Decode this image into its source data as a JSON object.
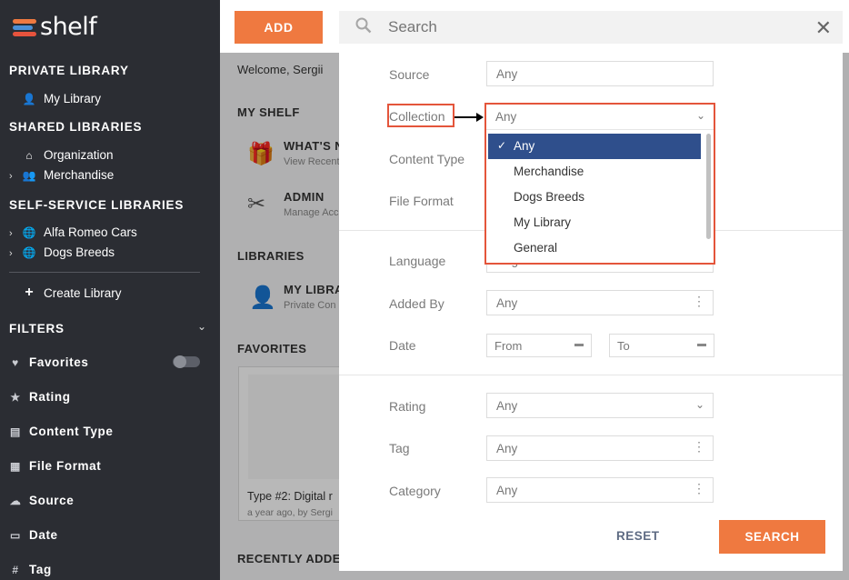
{
  "app": {
    "logo_text": "shelf"
  },
  "sidebar": {
    "private_library": {
      "heading": "PRIVATE LIBRARY",
      "items": [
        {
          "label": "My Library",
          "icon": "lock-user-icon"
        }
      ]
    },
    "shared_libraries": {
      "heading": "SHARED LIBRARIES",
      "items": [
        {
          "label": "Organization",
          "icon": "building-icon"
        },
        {
          "label": "Merchandise",
          "icon": "users-icon"
        }
      ]
    },
    "self_service_libraries": {
      "heading": "SELF-SERVICE LIBRARIES",
      "items": [
        {
          "label": "Alfa Romeo Cars",
          "icon": "globe-icon"
        },
        {
          "label": "Dogs Breeds",
          "icon": "globe-icon"
        }
      ]
    },
    "create_library": "Create Library",
    "filters": {
      "heading": "FILTERS",
      "items": [
        {
          "label": "Favorites",
          "icon": "heart-icon"
        },
        {
          "label": "Rating",
          "icon": "star-icon"
        },
        {
          "label": "Content Type",
          "icon": "document-icon"
        },
        {
          "label": "File Format",
          "icon": "file-icon"
        },
        {
          "label": "Source",
          "icon": "cloud-icon"
        },
        {
          "label": "Date",
          "icon": "calendar-icon"
        },
        {
          "label": "Tag",
          "icon": "hash-icon"
        }
      ]
    }
  },
  "main": {
    "add_label": "ADD",
    "welcome": "Welcome, Sergii",
    "my_shelf_heading": "MY SHELF",
    "whats_new": "WHAT'S N",
    "whats_new_sub": "View Recent",
    "admin": "ADMIN",
    "admin_sub": "Manage Acc",
    "libraries_heading": "LIBRARIES",
    "my_library": "MY LIBRA",
    "my_library_sub": "Private Con",
    "favorites_heading": "FAVORITES",
    "card_title": "Type #2: Digital r",
    "card_meta": "a year ago, by Sergi",
    "recently_added_heading": "RECENTLY ADDED"
  },
  "search": {
    "placeholder": "Search",
    "fields": {
      "source": {
        "label": "Source",
        "value": "Any"
      },
      "collection": {
        "label": "Collection",
        "value": "Any"
      },
      "content_type": {
        "label": "Content Type"
      },
      "file_format": {
        "label": "File Format"
      },
      "language": {
        "label": "Language",
        "value": "English"
      },
      "added_by": {
        "label": "Added By",
        "value": "Any"
      },
      "date": {
        "label": "Date",
        "from": "From",
        "to": "To"
      },
      "rating": {
        "label": "Rating",
        "value": "Any"
      },
      "tag": {
        "label": "Tag",
        "value": "Any"
      },
      "category": {
        "label": "Category",
        "value": "Any"
      }
    },
    "collection_options": [
      "Any",
      "Merchandise",
      "Dogs Breeds",
      "My Library",
      "General"
    ],
    "collection_selected": "Any",
    "reset_label": "RESET",
    "search_label": "SEARCH"
  },
  "colors": {
    "accent": "#ef7940",
    "selected": "#2f4f8c",
    "annotation": "#e4553b",
    "sidebar": "#2b2d33"
  }
}
